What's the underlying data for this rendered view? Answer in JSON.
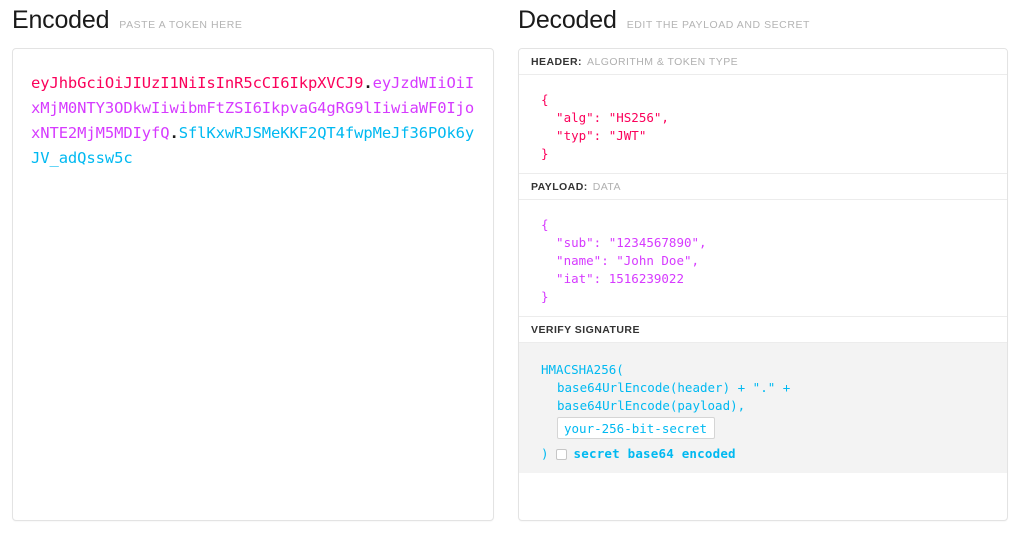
{
  "encoded": {
    "title": "Encoded",
    "subtitle": "PASTE A TOKEN HERE",
    "token": {
      "header": "eyJhbGciOiJIUzI1NiIsInR5cCI6IkpXVCJ9",
      "dot1": ".",
      "payload": "eyJzdWIiOiIxMjM0NTY3ODkwIiwibmFtZSI6IkpvaG4gRG9lIiwiaWF0IjoxNTE2MjM5MDIyfQ",
      "dot2": ".",
      "signature": "SflKxwRJSMeKKF2QT4fwpMeJf36POk6yJV_adQssw5c"
    }
  },
  "decoded": {
    "title": "Decoded",
    "subtitle": "EDIT THE PAYLOAD AND SECRET",
    "sections": {
      "header": {
        "label": "HEADER:",
        "description": "ALGORITHM & TOKEN TYPE",
        "content": "{\n  \"alg\": \"HS256\",\n  \"typ\": \"JWT\"\n}"
      },
      "payload": {
        "label": "PAYLOAD:",
        "description": "DATA",
        "content": "{\n  \"sub\": \"1234567890\",\n  \"name\": \"John Doe\",\n  \"iat\": 1516239022\n}"
      },
      "signature": {
        "label": "VERIFY SIGNATURE",
        "description": "",
        "line1": "HMACSHA256(",
        "line2": "base64UrlEncode(header) + \".\" +",
        "line3": "base64UrlEncode(payload),",
        "secret_value": "your-256-bit-secret",
        "secret_placeholder": "your-256-bit-secret",
        "closing_paren": ")",
        "base64_label": "secret base64 encoded",
        "base64_checked": false
      }
    }
  },
  "colors": {
    "header_segment": "#fb015b",
    "payload_segment": "#d63aff",
    "signature_segment": "#00b9f1",
    "panel_border": "#e3e3e3",
    "signature_body_bg": "#f3f3f3"
  }
}
